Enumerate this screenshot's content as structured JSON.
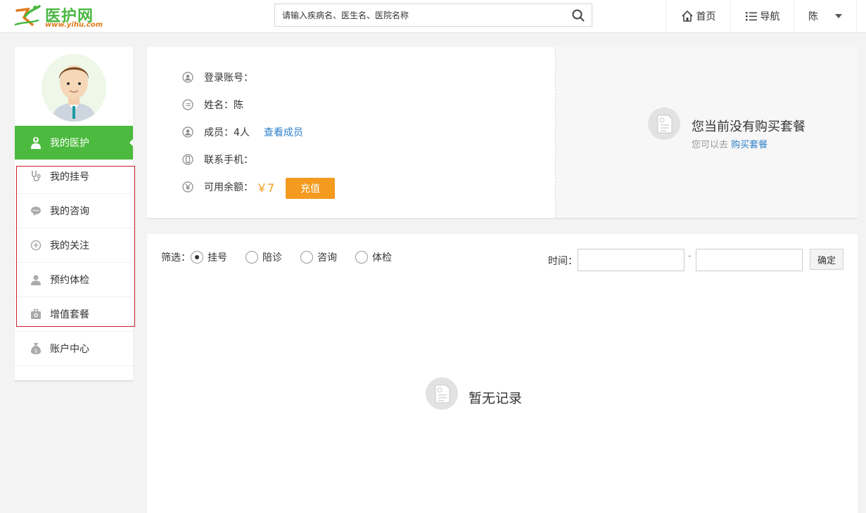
{
  "header": {
    "logo_name": "医护网",
    "logo_url": "www.yihu.com",
    "search_placeholder": "请输入疾病名、医生名、医院名称",
    "nav": {
      "home": "首页",
      "guide": "导航",
      "user": "陈"
    }
  },
  "sidebar": {
    "active": "我的医护",
    "items": [
      {
        "label": "我的挂号",
        "icon": "stethoscope-icon"
      },
      {
        "label": "我的咨询",
        "icon": "chat-icon"
      },
      {
        "label": "我的关注",
        "icon": "plus-circle-icon"
      },
      {
        "label": "预约体检",
        "icon": "person-icon"
      },
      {
        "label": "增值套餐",
        "icon": "medkit-icon"
      },
      {
        "label": "账户中心",
        "icon": "moneybag-icon"
      }
    ]
  },
  "profile": {
    "account_label": "登录账号：",
    "name_label": "姓名：陈",
    "members_label": "成员：4人",
    "view_members": "查看成员",
    "phone_label": "联系手机：",
    "balance_label": "可用余额：",
    "balance_value": "￥7",
    "recharge": "充值"
  },
  "package": {
    "empty_title": "您当前没有购买套餐",
    "hint_prefix": "您可以去",
    "buy_link": "购买套餐"
  },
  "records": {
    "filter_label": "筛选：",
    "options": [
      "挂号",
      "陪诊",
      "咨询",
      "体检"
    ],
    "selected": "挂号",
    "time_label": "时间：",
    "date_sep": "-",
    "confirm": "确定",
    "empty": "暂无记录"
  },
  "colors": {
    "brand_green": "#4cba3e",
    "accent_orange": "#f39a1f",
    "link_blue": "#2a7fc9",
    "highlight_red": "#c8222a"
  }
}
